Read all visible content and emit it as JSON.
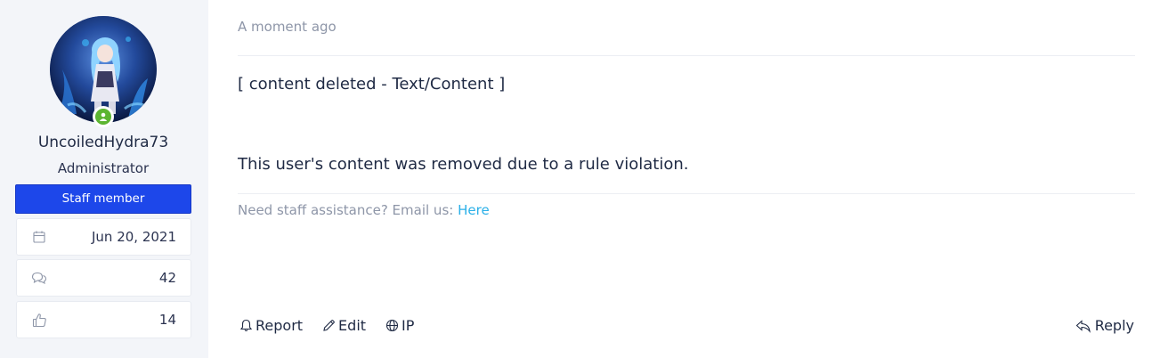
{
  "post": {
    "user": {
      "username": "UncoiledHydra73",
      "title": "Administrator",
      "badge": "Staff member",
      "avatar_icon": "anime-character-avatar",
      "status_icon": "online-user-icon",
      "status_color": "#5cb531",
      "badge_color": "#1d47ea",
      "stats": [
        {
          "icon": "calendar-icon",
          "value": "Jun 20, 2021"
        },
        {
          "icon": "messages-icon",
          "value": "42"
        },
        {
          "icon": "thumbs-up-icon",
          "value": "14"
        }
      ]
    },
    "timestamp": "A moment ago",
    "content": {
      "line1": "[ content deleted - Text/Content ]",
      "line2": "This user's content was removed due to a rule violation."
    },
    "signature": {
      "text": "Need staff assistance? Email us:",
      "link_label": "Here",
      "link_color": "#2bb0e8"
    },
    "actions": {
      "report_label": "Report",
      "edit_label": "Edit",
      "ip_label": "IP",
      "reply_label": "Reply"
    }
  }
}
